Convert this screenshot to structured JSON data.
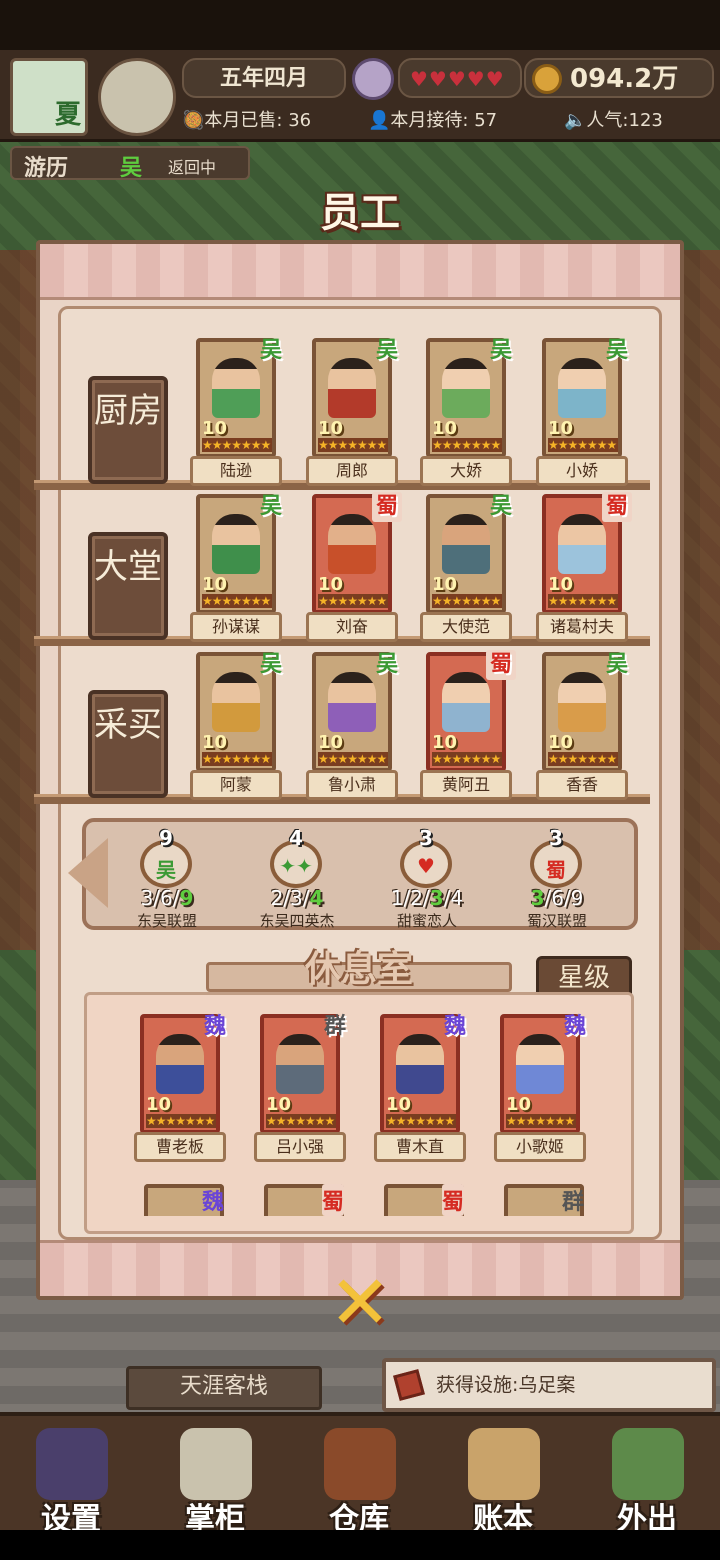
{
  "hud": {
    "season": "夏",
    "date": "五年四月",
    "hearts": "♥♥♥♥♥",
    "money": "094.2万",
    "sold_label": "本月已售:",
    "sold_value": "36",
    "served_label": "本月接待:",
    "served_value": "57",
    "popularity": "人气:123"
  },
  "travel": {
    "label": "游历",
    "faction": "吴",
    "status": "返回中"
  },
  "title": "员工",
  "departments": [
    {
      "name": "厨房",
      "staff": [
        {
          "name": "陆逊",
          "faction": "吴",
          "level": "10",
          "stars": "★★★★★★★",
          "skin": "#e9c39f",
          "robe": "#4f9e57"
        },
        {
          "name": "周郎",
          "faction": "吴",
          "level": "10",
          "stars": "★★★★★★★",
          "skin": "#e9c39f",
          "robe": "#b33a2a"
        },
        {
          "name": "大娇",
          "faction": "吴",
          "level": "10",
          "stars": "★★★★★★★",
          "skin": "#f0cfb0",
          "robe": "#6cab5c"
        },
        {
          "name": "小娇",
          "faction": "吴",
          "level": "10",
          "stars": "★★★★★★★",
          "skin": "#f0cfb0",
          "robe": "#7db4c9"
        }
      ]
    },
    {
      "name": "大堂",
      "staff": [
        {
          "name": "孙谋谋",
          "faction": "吴",
          "level": "10",
          "stars": "★★★★★★★",
          "skin": "#e9c39f",
          "robe": "#3f8f4b"
        },
        {
          "name": "刘奋",
          "faction": "蜀",
          "level": "10",
          "stars": "★★★★★★★",
          "skin": "#e2b08a",
          "robe": "#c8502a"
        },
        {
          "name": "大使范",
          "faction": "吴",
          "level": "10",
          "stars": "★★★★★★★",
          "skin": "#d9a47c",
          "robe": "#4e6f7a"
        },
        {
          "name": "诸葛村夫",
          "faction": "蜀",
          "level": "10",
          "stars": "★★★★★★★",
          "skin": "#ecc6a4",
          "robe": "#9cc3dc"
        }
      ]
    },
    {
      "name": "采买",
      "staff": [
        {
          "name": "阿蒙",
          "faction": "吴",
          "level": "10",
          "stars": "★★★★★★★",
          "skin": "#e9c39f",
          "robe": "#d29a3d"
        },
        {
          "name": "鲁小肃",
          "faction": "吴",
          "level": "10",
          "stars": "★★★★★★★",
          "skin": "#e9c39f",
          "robe": "#8e5fb8"
        },
        {
          "name": "黄阿丑",
          "faction": "蜀",
          "level": "10",
          "stars": "★★★★★★★",
          "skin": "#f0cfb0",
          "robe": "#8fb3cf"
        },
        {
          "name": "香香",
          "faction": "吴",
          "level": "10",
          "stars": "★★★★★★★",
          "skin": "#f0cfb0",
          "robe": "#d99c4a"
        }
      ]
    }
  ],
  "bonds": [
    {
      "count": "9",
      "icon": "吴",
      "pre": "3/6/",
      "hi": "9",
      "post": "",
      "label": "东吴联盟"
    },
    {
      "count": "4",
      "icon": "✦✦",
      "pre": "2/3/",
      "hi": "4",
      "post": "",
      "label": "东吴四英杰"
    },
    {
      "count": "3",
      "icon": "♥",
      "pre": "1/2/",
      "hi": "3",
      "post": "/4",
      "label": "甜蜜恋人"
    },
    {
      "count": "3",
      "icon": "蜀",
      "pre": "",
      "hi": "3",
      "post": "/6/9",
      "label": "蜀汉联盟"
    }
  ],
  "rest": {
    "title": "休息室",
    "sort_label": "星级",
    "staff": [
      {
        "name": "曹老板",
        "faction": "魏",
        "level": "10",
        "stars": "★★★★★★★",
        "skin": "#d9a47c",
        "robe": "#3d4f9a"
      },
      {
        "name": "吕小强",
        "faction": "群",
        "level": "10",
        "stars": "★★★★★★★",
        "skin": "#d9a47c",
        "robe": "#5d6b7a"
      },
      {
        "name": "曹木直",
        "faction": "魏",
        "level": "10",
        "stars": "★★★★★★★",
        "skin": "#e9c39f",
        "robe": "#40498f"
      },
      {
        "name": "小歌姬",
        "faction": "魏",
        "level": "10",
        "stars": "★★★★★★★",
        "skin": "#f0cfb0",
        "robe": "#6f88d6"
      }
    ],
    "more_factions": [
      "魏",
      "蜀",
      "蜀",
      "群"
    ]
  },
  "inn_name": "天涯客栈",
  "toast": "获得设施:乌足案",
  "nav": [
    "设置",
    "掌柜",
    "仓库",
    "账本",
    "外出"
  ],
  "colors": {
    "wu": "#3b9a34",
    "shu": "#d52b22",
    "wei": "#6a45d6",
    "panel": "#e9d4c6"
  }
}
